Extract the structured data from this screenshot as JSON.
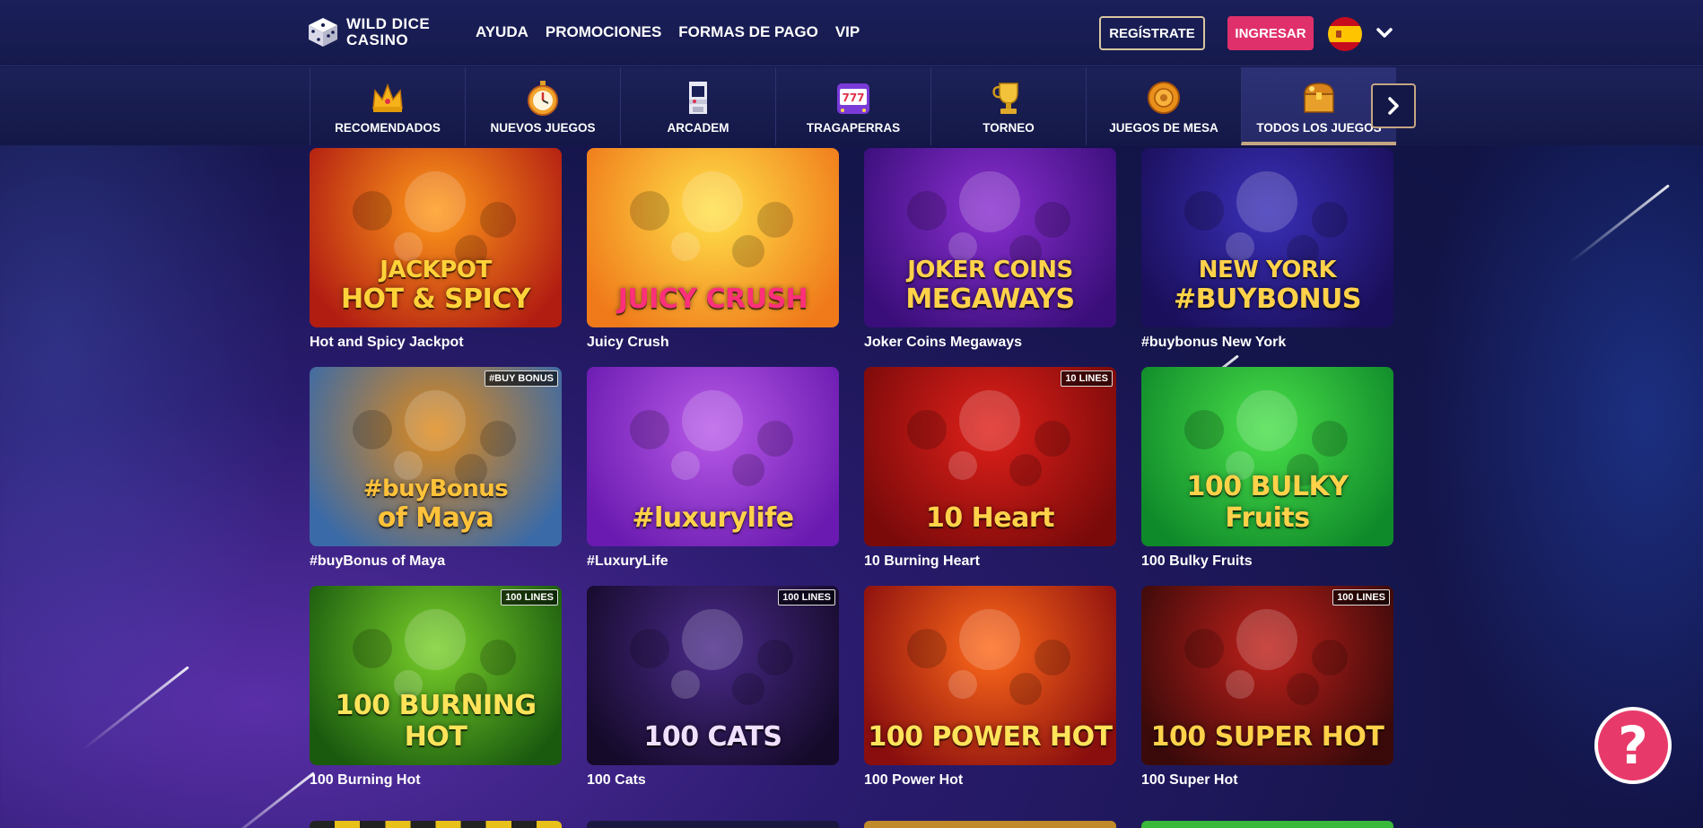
{
  "brand": {
    "line1": "WILD DICE",
    "line2": "CASINO"
  },
  "nav": [
    "AYUDA",
    "PROMOCIONES",
    "FORMAS DE PAGO",
    "VIP"
  ],
  "auth": {
    "register": "REGÍSTRATE",
    "login": "INGRESAR"
  },
  "language": {
    "flag": "spain-flag-icon"
  },
  "categories": [
    {
      "label": "RECOMENDADOS",
      "icon": "crown-icon"
    },
    {
      "label": "NUEVOS JUEGOS",
      "icon": "stopwatch-icon"
    },
    {
      "label": "ARCADEM",
      "icon": "arcade-icon"
    },
    {
      "label": "TRAGAPERRAS",
      "icon": "slot-machine-icon"
    },
    {
      "label": "TORNEO",
      "icon": "trophy-icon"
    },
    {
      "label": "JUEGOS DE MESA",
      "icon": "chip-icon"
    },
    {
      "label": "TODOS LOS JUEGOS",
      "icon": "treasure-chest-icon",
      "active": true
    }
  ],
  "games": [
    {
      "name": "Hot and Spicy Jackpot",
      "art": "JACKPOT\nHOT & SPICY",
      "colors": [
        "#ff9a1a",
        "#b21d12"
      ],
      "text": "#ffd23a"
    },
    {
      "name": "Juicy Crush",
      "art": "JUICY CRUSH",
      "colors": [
        "#ffe14a",
        "#f07a1a"
      ],
      "text": "#ff2f7a"
    },
    {
      "name": "Joker Coins Megaways",
      "art": "JOKER COINS\nMEGAWAYS",
      "colors": [
        "#8a2fd0",
        "#3a0e7a"
      ],
      "text": "#ffd24a"
    },
    {
      "name": "#buybonus New York",
      "art": "NEW YORK\n#BUYBONUS",
      "colors": [
        "#3a2fb8",
        "#1a0f5a"
      ],
      "text": "#ffd24a"
    },
    {
      "name": "#buyBonus of Maya",
      "art": "#buyBonus\nof Maya",
      "colors": [
        "#e08a1a",
        "#3a6aa8"
      ],
      "text": "#ffc23a",
      "badge": "#BUY BONUS"
    },
    {
      "name": "#LuxuryLife",
      "art": "#luxurylife",
      "colors": [
        "#b85ae8",
        "#6a1ab0"
      ],
      "text": "#ffd24a"
    },
    {
      "name": "10 Burning Heart",
      "art": "10 Heart",
      "colors": [
        "#e0201a",
        "#7a0a0a"
      ],
      "text": "#ffd24a",
      "badge": "10 LINES"
    },
    {
      "name": "100 Bulky Fruits",
      "art": "100 BULKY Fruits",
      "colors": [
        "#4ae04a",
        "#0f8a2a"
      ],
      "text": "#ffd24a"
    },
    {
      "name": "100 Burning Hot",
      "art": "100 BURNING HOT",
      "colors": [
        "#7ad02a",
        "#1a5a0f"
      ],
      "text": "#ffe45a",
      "badge": "100 LINES"
    },
    {
      "name": "100 Cats",
      "art": "100 CATS",
      "colors": [
        "#4a2a8a",
        "#150a2a"
      ],
      "text": "#f0e0ff",
      "badge": "100 LINES"
    },
    {
      "name": "100 Power Hot",
      "art": "100 POWER HOT",
      "colors": [
        "#ff6a1a",
        "#8a0e0e"
      ],
      "text": "#ffe45a"
    },
    {
      "name": "100 Super Hot",
      "art": "100 SUPER HOT",
      "colors": [
        "#c0201a",
        "#3a0a0a"
      ],
      "text": "#ffd24a",
      "badge": "100 LINES"
    }
  ],
  "help": {
    "label": "?"
  }
}
